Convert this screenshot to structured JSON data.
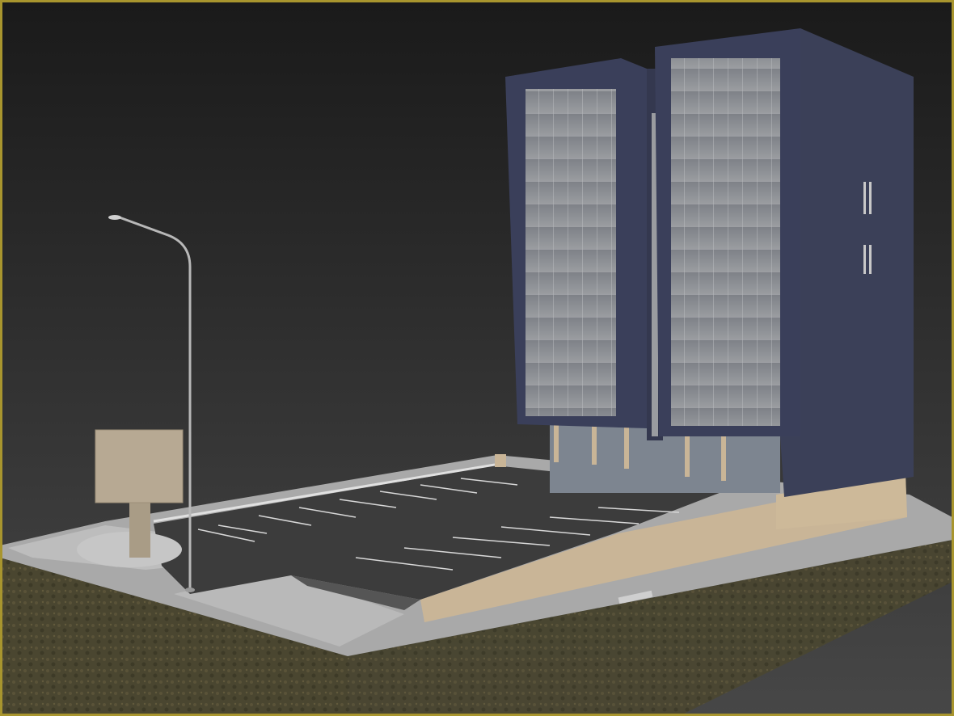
{
  "viewport": {
    "active_border_color": "#a8952e",
    "background_top": "#1a1a1a",
    "background_bottom": "#474747"
  },
  "scene": {
    "objects": [
      "office-building",
      "parking-lot",
      "street-lamp",
      "billboard",
      "terrain-block"
    ],
    "building_color": "#3a3f5a",
    "glass_color": "#8c8f94",
    "stone_color": "#c9b597",
    "asphalt_color": "#3c3c3c",
    "soil_color": "#4a4630"
  }
}
